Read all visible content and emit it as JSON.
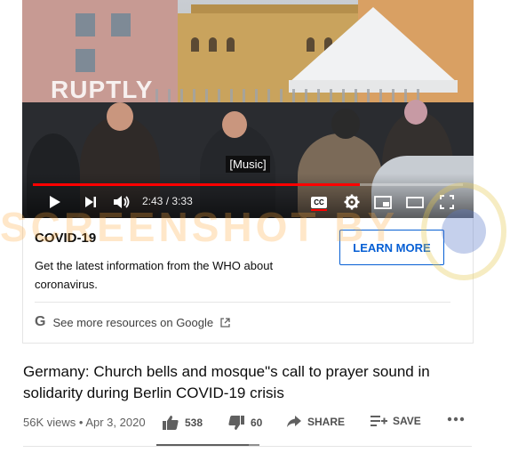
{
  "player": {
    "channel_watermark": "RUPTLY",
    "caption": "[Music]",
    "time_current": "2:43",
    "time_separator": "/",
    "time_total": "3:33",
    "progress_percent": 76,
    "cc_label": "CC"
  },
  "covid_card": {
    "title": "COVID-19",
    "text": "Get the latest information from the WHO about coronavirus.",
    "button_label": "LEARN MORE",
    "resources_label": "See more resources on Google",
    "google_glyph": "G"
  },
  "video": {
    "title": "Germany: Church bells and mosque\"s call to prayer sound in solidarity during Berlin COVID-19 crisis",
    "views": "56K views",
    "dot": "•",
    "date": "Apr 3, 2020",
    "likes": "538",
    "dislikes": "60",
    "share_label": "SHARE",
    "save_label": "SAVE",
    "like_ratio_percent": 90
  },
  "overlay": {
    "watermark_text": "SCREENSHOT BY"
  },
  "colors": {
    "progress": "#ff0000",
    "link_blue": "#065fd4"
  }
}
